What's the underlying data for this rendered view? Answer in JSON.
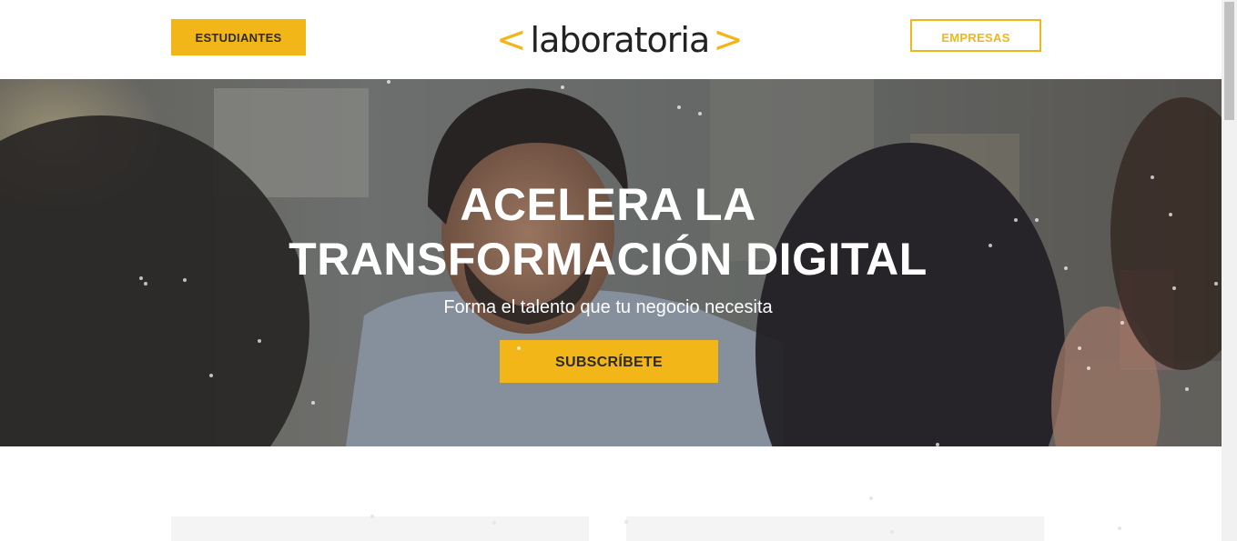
{
  "header": {
    "students_label": "ESTUDIANTES",
    "companies_label": "EMPRESAS",
    "logo": {
      "left_bracket": "<",
      "word": "laboratoria",
      "right_bracket": ">"
    }
  },
  "hero": {
    "title_line1": "ACELERA LA",
    "title_line2": "TRANSFORMACIÓN DIGITAL",
    "subtitle": "Forma el talento que tu negocio necesita",
    "cta_label": "SUBSCRÍBETE"
  },
  "colors": {
    "accent": "#f3b618",
    "text_dark": "#2b2b2b",
    "card_bg": "#f4f4f4"
  }
}
